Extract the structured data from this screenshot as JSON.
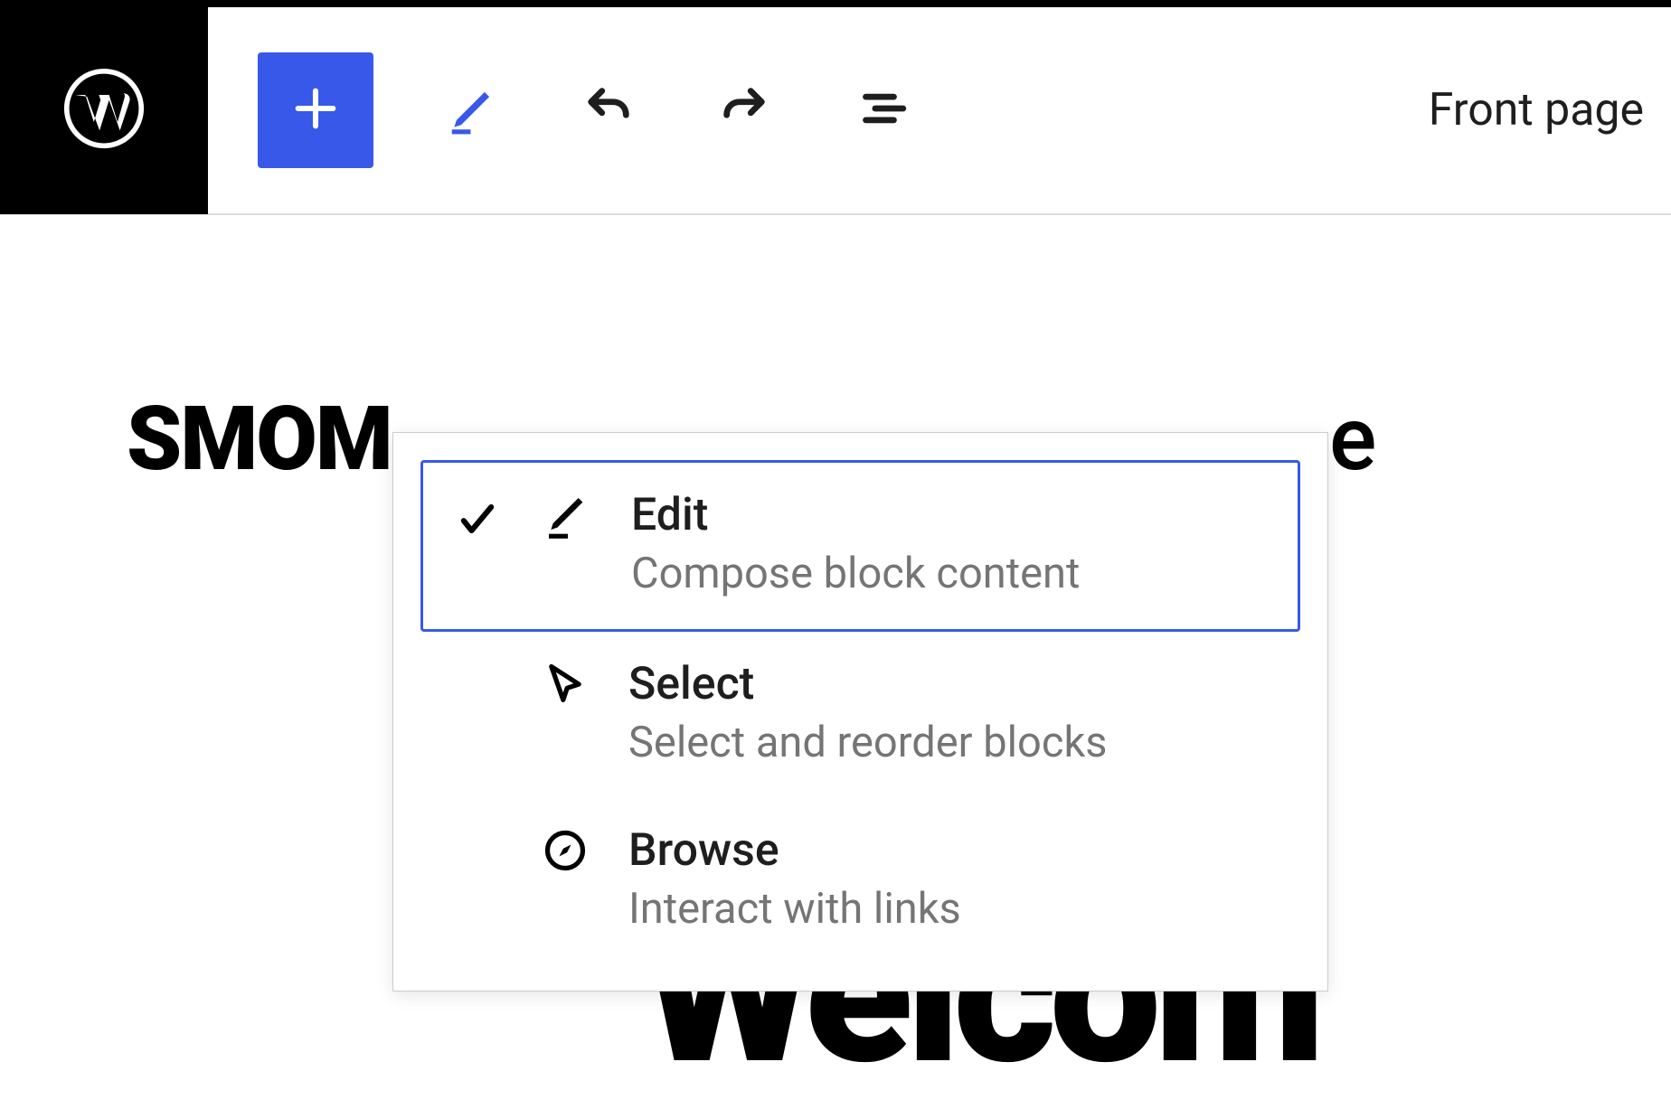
{
  "toolbar": {
    "page_label": "Front page"
  },
  "content": {
    "site_title": "SMOM",
    "trailing_char": "e",
    "welcome_partial": "Welcom"
  },
  "dropdown": {
    "items": [
      {
        "title": "Edit",
        "desc": "Compose block content",
        "selected": true
      },
      {
        "title": "Select",
        "desc": "Select and reorder blocks",
        "selected": false
      },
      {
        "title": "Browse",
        "desc": "Interact with links",
        "selected": false
      }
    ]
  }
}
